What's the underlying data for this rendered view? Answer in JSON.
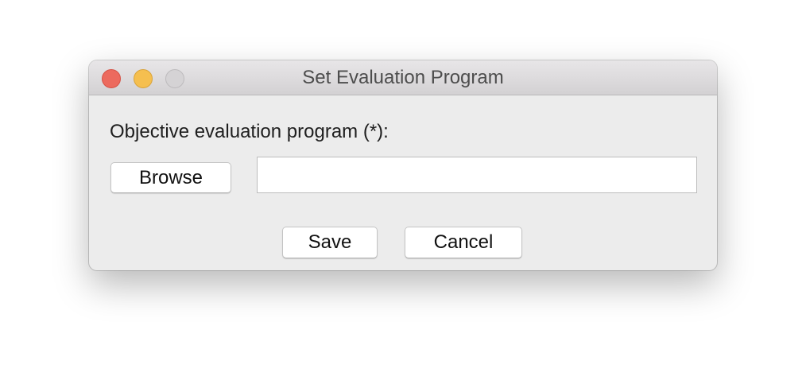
{
  "window": {
    "title": "Set Evaluation Program"
  },
  "form": {
    "label": "Objective evaluation program (*):",
    "browse_label": "Browse",
    "path_value": "",
    "path_placeholder": ""
  },
  "actions": {
    "save_label": "Save",
    "cancel_label": "Cancel"
  },
  "colors": {
    "close": "#ec6a5e",
    "minimize": "#f5bf4f",
    "zoom_disabled": "#d5d3d5",
    "window_bg": "#ececec"
  },
  "icons": {
    "close": "close-window-icon",
    "minimize": "minimize-window-icon",
    "zoom": "zoom-window-icon"
  }
}
